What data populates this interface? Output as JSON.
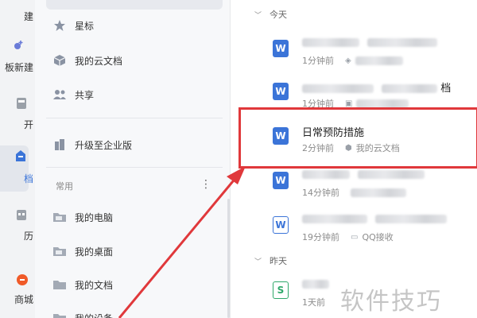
{
  "rail": {
    "items": [
      {
        "label": "建",
        "icon": "create-icon"
      },
      {
        "label": "板新建",
        "icon": "template-new-icon"
      },
      {
        "label": "开",
        "icon": "open-icon"
      },
      {
        "label": "档",
        "icon": "document-icon"
      },
      {
        "label": "历",
        "icon": "calendar-icon"
      },
      {
        "label": "商城",
        "icon": "store-icon"
      }
    ]
  },
  "sidebar": {
    "nav": [
      {
        "label": "星标",
        "icon": "star-icon"
      },
      {
        "label": "我的云文档",
        "icon": "cloud-doc-icon"
      },
      {
        "label": "共享",
        "icon": "share-icon"
      }
    ],
    "upgrade": {
      "label": "升级至企业版",
      "icon": "building-icon"
    },
    "section_label": "常用",
    "more": "⋮",
    "common": [
      {
        "label": "我的电脑",
        "icon": "folder-icon"
      },
      {
        "label": "我的桌面",
        "icon": "folder-icon"
      },
      {
        "label": "我的文档",
        "icon": "folder-icon"
      },
      {
        "label": "我的设备",
        "icon": "folder-icon"
      }
    ]
  },
  "main": {
    "groups": [
      {
        "label": "今天"
      },
      {
        "label": "昨天"
      }
    ],
    "rows": [
      {
        "title": "",
        "time": "1分钟前",
        "location": "",
        "type": "w"
      },
      {
        "title": "档",
        "time": "1分钟前",
        "location": "",
        "type": "w"
      },
      {
        "title": "日常预防措施",
        "time": "2分钟前",
        "location": "我的云文档",
        "type": "w"
      },
      {
        "title": "",
        "time": "14分钟前",
        "location": "",
        "type": "w"
      },
      {
        "title": "",
        "time": "19分钟前",
        "location": "QQ接收",
        "type": "w-outline"
      },
      {
        "title": "",
        "time": "1天前",
        "location": "",
        "type": "s"
      }
    ]
  },
  "watermark": "软件技巧",
  "colors": {
    "accent": "#3b74d8",
    "highlight": "#e0383b",
    "sheet": "#2fa86a"
  }
}
